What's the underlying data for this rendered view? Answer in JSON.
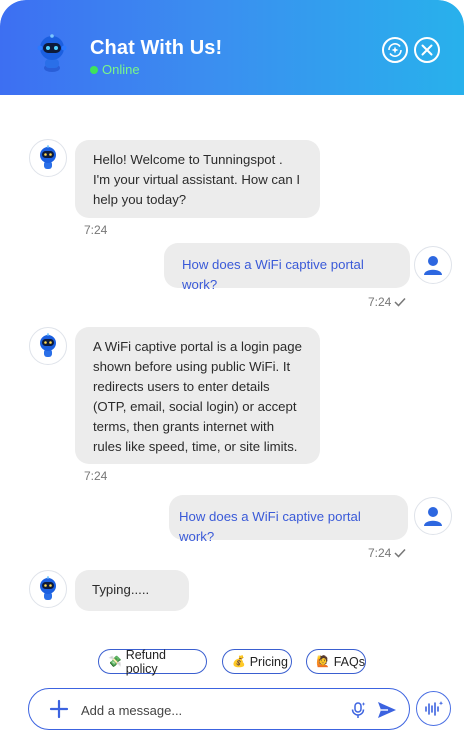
{
  "header": {
    "title": "Chat With Us!",
    "status": "Online",
    "bot_icon": "robot-icon",
    "refresh_icon": "refresh-ai-icon",
    "close_icon": "close-icon"
  },
  "messages": [
    {
      "from": "bot",
      "lines": [
        "Hello! Welcome to Tunningspot .",
        "I'm your virtual assistant. How can I",
        "help you today?"
      ],
      "time": "7:24"
    },
    {
      "from": "user",
      "text": "How does a WiFi captive portal work?",
      "time": "7:24"
    },
    {
      "from": "bot",
      "lines": [
        "A WiFi captive portal is a login page",
        "shown before using public WiFi. It",
        "redirects users to enter details",
        "(OTP, email, social login) or accept",
        "terms, then grants internet with",
        "rules like speed, time, or site limits."
      ],
      "time": "7:24"
    },
    {
      "from": "user",
      "text": "How does a WiFi captive portal work?",
      "time": "7:24"
    },
    {
      "from": "bot",
      "typing": "Typing....."
    }
  ],
  "quick_replies": [
    {
      "emoji": "💸",
      "label": "Refund policy"
    },
    {
      "emoji": "💰",
      "label": "Pricing"
    },
    {
      "emoji": "🙋",
      "label": "FAQs"
    }
  ],
  "composer": {
    "placeholder": "Add a message...",
    "value": ""
  },
  "colors": {
    "header_start": "#3d6ff2",
    "header_end": "#28b1ec",
    "accent": "#3c63e0",
    "online": "#3ee35b",
    "bubble": "#ececec"
  }
}
